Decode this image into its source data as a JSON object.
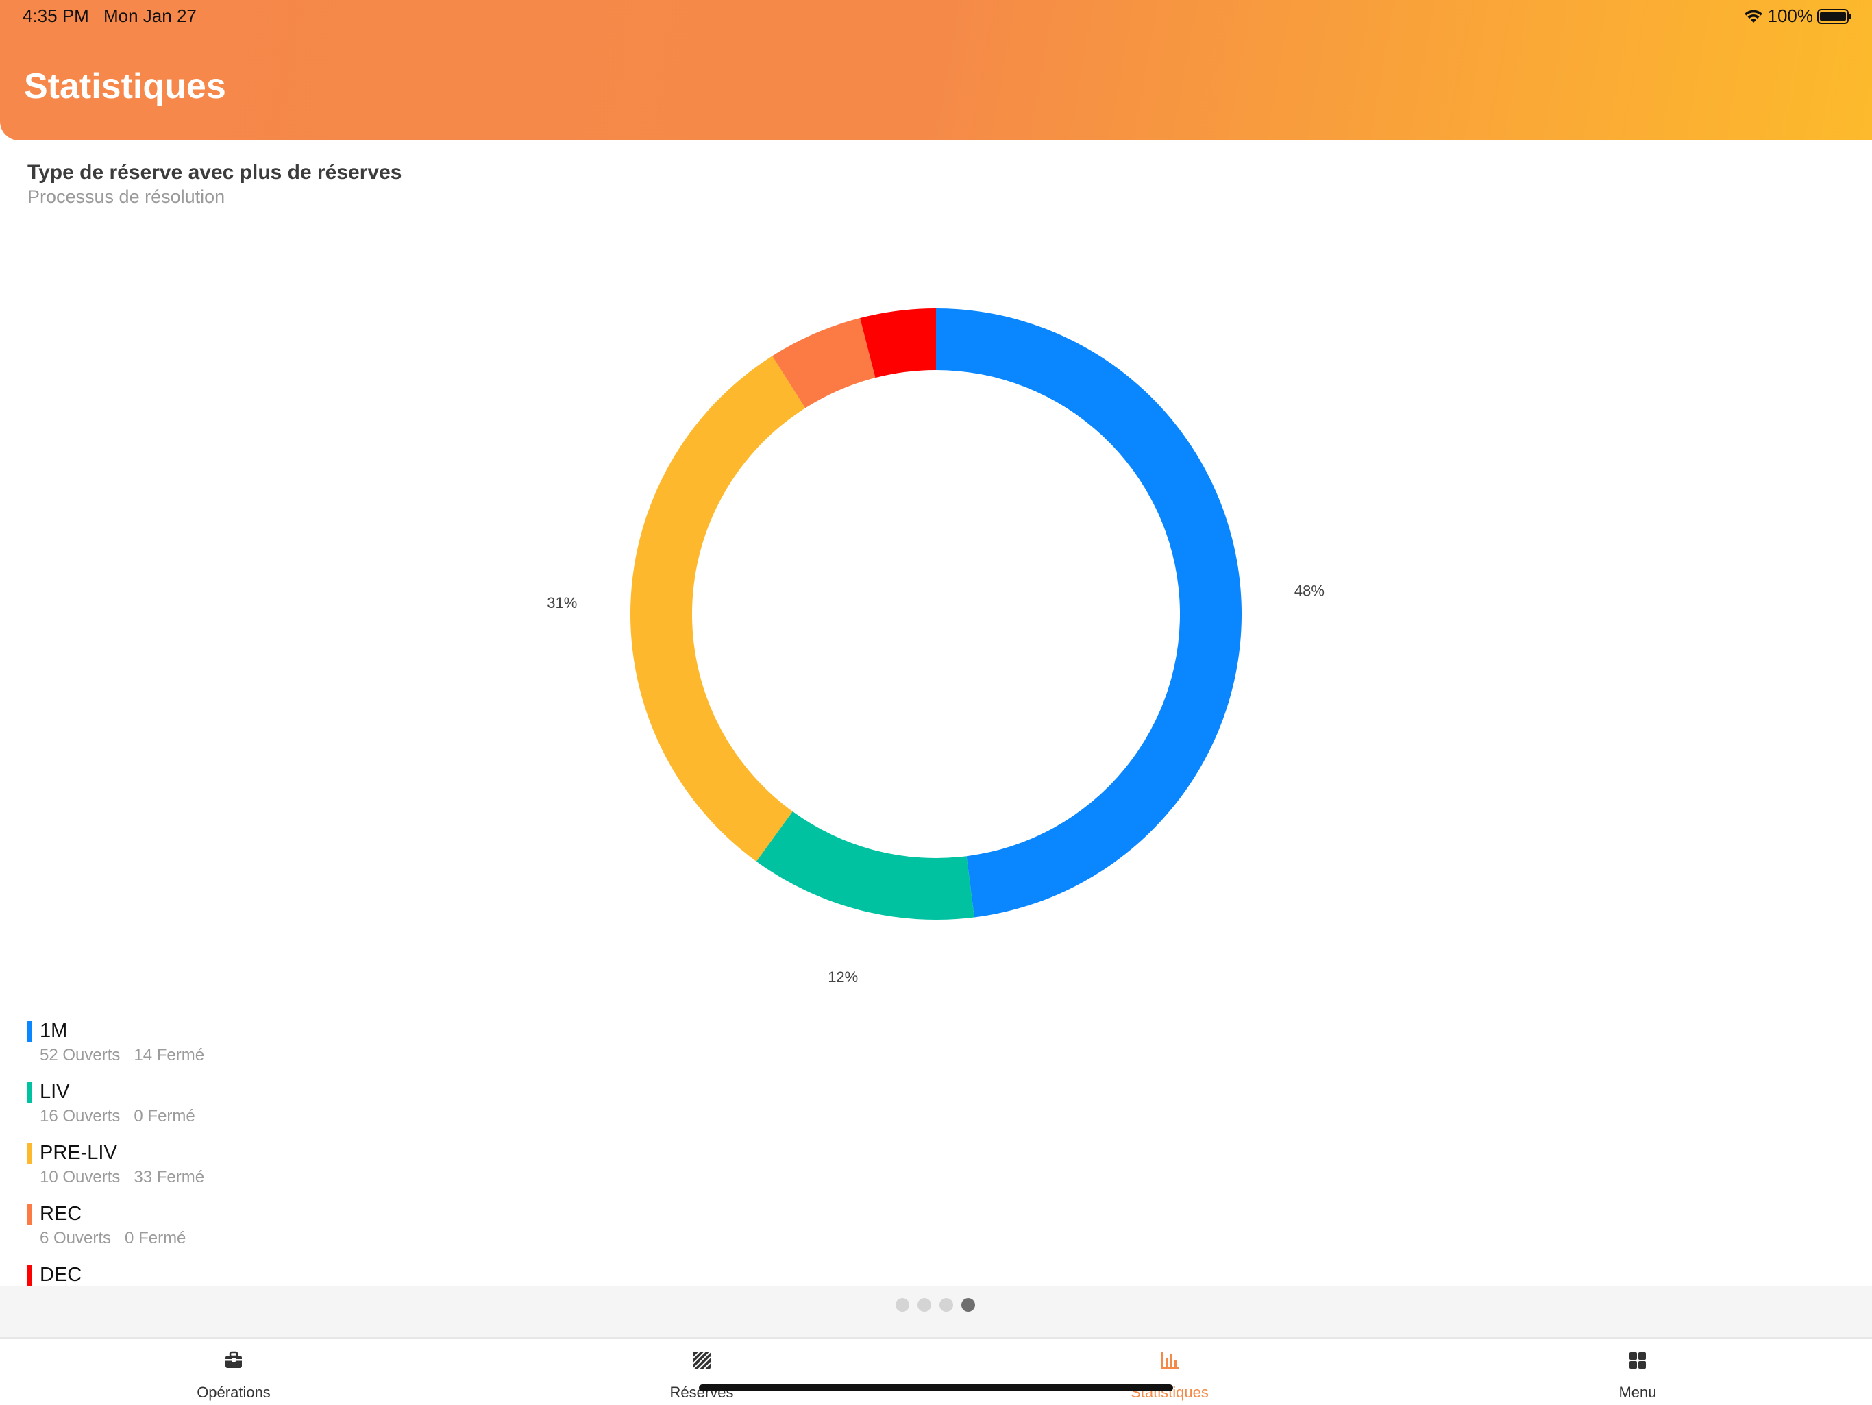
{
  "status_bar": {
    "time": "4:35 PM",
    "date": "Mon Jan 27",
    "battery": "100%"
  },
  "header": {
    "title": "Statistiques"
  },
  "chart_section": {
    "title": "Type de réserve avec plus de réserves",
    "subtitle": "Processus de résolution"
  },
  "chart_data": {
    "type": "pie",
    "categories": [
      "1M",
      "LIV",
      "PRE-LIV",
      "REC",
      "DEC"
    ],
    "values": [
      48,
      12,
      31,
      5,
      4
    ],
    "colors": [
      "#0a86fe",
      "#00c2a0",
      "#fdb82d",
      "#fc7b45",
      "#ff0000"
    ],
    "data_labels": [
      "48%",
      "12%",
      "31%",
      "",
      ""
    ]
  },
  "legend": [
    {
      "label": "1M",
      "opened": "52 Ouverts",
      "closed": "14 Fermé",
      "color": "#0a86fe"
    },
    {
      "label": "LIV",
      "opened": "16 Ouverts",
      "closed": "0 Fermé",
      "color": "#00c2a0"
    },
    {
      "label": "PRE-LIV",
      "opened": "10 Ouverts",
      "closed": "33 Fermé",
      "color": "#fdb82d"
    },
    {
      "label": "REC",
      "opened": "6 Ouverts",
      "closed": "0 Fermé",
      "color": "#fc7b45"
    },
    {
      "label": "DEC",
      "opened": "",
      "closed": "",
      "color": "#ff0000"
    }
  ],
  "pager": {
    "count": 4,
    "active_index": 3
  },
  "tabbar": {
    "accent_color": "#f58a48",
    "tabs": [
      {
        "label": "Opérations",
        "icon": "briefcase-icon"
      },
      {
        "label": "Réserves",
        "icon": "hatched-square-icon"
      },
      {
        "label": "Statistiques",
        "icon": "bar-chart-icon"
      },
      {
        "label": "Menu",
        "icon": "grid-icon"
      }
    ]
  }
}
